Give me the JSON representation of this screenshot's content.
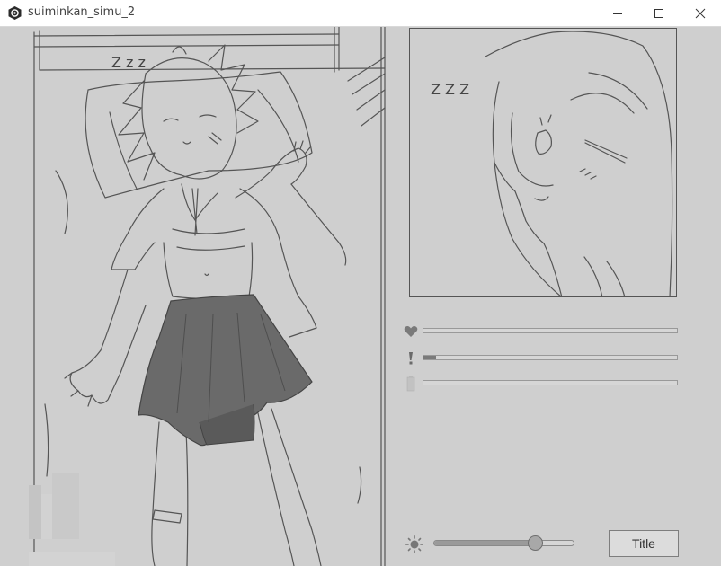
{
  "window": {
    "title": "suiminkan_simu_2",
    "app_icon": "gear-cube-icon",
    "controls": {
      "minimize": "minimize-icon",
      "maximize": "maximize-icon",
      "close": "close-icon"
    }
  },
  "scene": {
    "main_sleep_mark": "Z z z",
    "closeup_sleep_mark": "Z Z Z"
  },
  "gauges": [
    {
      "id": "affection",
      "icon": "heart-icon",
      "level": 0.0
    },
    {
      "id": "alert",
      "icon": "exclamation-icon",
      "level": 0.05
    },
    {
      "id": "stamina",
      "icon": "battery-icon",
      "level": 0.0
    }
  ],
  "controls": {
    "brightness_icon": "sun-icon",
    "brightness_level": 0.72,
    "title_button_label": "Title"
  },
  "colors": {
    "background": "#cfcfcf",
    "line": "#555555",
    "skirt": "#6a6a6a",
    "gauge_fill": "#7a7a7a"
  }
}
